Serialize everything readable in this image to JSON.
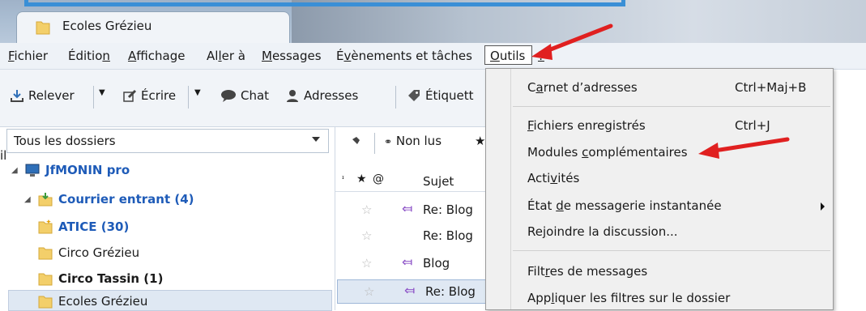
{
  "tab": {
    "title": "Ecoles Grézieu"
  },
  "menubar": {
    "items": [
      {
        "label": "Fichier",
        "ul": "F"
      },
      {
        "label": "Édition",
        "ul": "n"
      },
      {
        "label": "Affichage",
        "ul": "A"
      },
      {
        "label": "Aller à",
        "ul": "l"
      },
      {
        "label": "Messages",
        "ul": "M"
      },
      {
        "label": "Évènements et tâches",
        "ul": "v"
      },
      {
        "label": "Outils",
        "ul": "O"
      },
      {
        "label": "?",
        "ul": "?"
      }
    ]
  },
  "toolbar": {
    "get_mail": "Relever",
    "write": "Écrire",
    "chat": "Chat",
    "address_book": "Adresses",
    "tag": "Étiquett"
  },
  "folders": {
    "header": "Tous les dossiers",
    "partial": "il",
    "account": "JfMONIN pro",
    "inbox": "Courrier entrant (4)",
    "items": [
      {
        "label": "ATICE (30)"
      },
      {
        "label": "Circo Grézieu"
      },
      {
        "label": "Circo Tassin (1)"
      },
      {
        "label": "Ecoles Grézieu"
      }
    ]
  },
  "messages": {
    "filter_unread": "Non lus",
    "col_subject": "Sujet",
    "rows": [
      {
        "subject": "Re: Blog"
      },
      {
        "subject": "Re: Blog"
      },
      {
        "subject": "Blog"
      },
      {
        "subject": "Re: Blog"
      }
    ]
  },
  "dropdown": {
    "items": [
      {
        "label": "Carnet d’adresses",
        "shortcut": "Ctrl+Maj+B"
      },
      {
        "label": "Fichiers enregistrés",
        "shortcut": "Ctrl+J"
      },
      {
        "label": "Modules complémentaires",
        "shortcut": ""
      },
      {
        "label": "Activités",
        "shortcut": ""
      },
      {
        "label": "État de messagerie instantanée",
        "shortcut": ""
      },
      {
        "label": "Rejoindre la discussion...",
        "shortcut": ""
      },
      {
        "label": "Filtres de messages",
        "shortcut": ""
      },
      {
        "label": "Appliquer les filtres sur le dossier",
        "shortcut": ""
      }
    ]
  },
  "colors": {
    "accent": "#3a8fd6",
    "annotation": "#e02020",
    "folder": "#f3cf6a",
    "link": "#1e5bb8"
  }
}
